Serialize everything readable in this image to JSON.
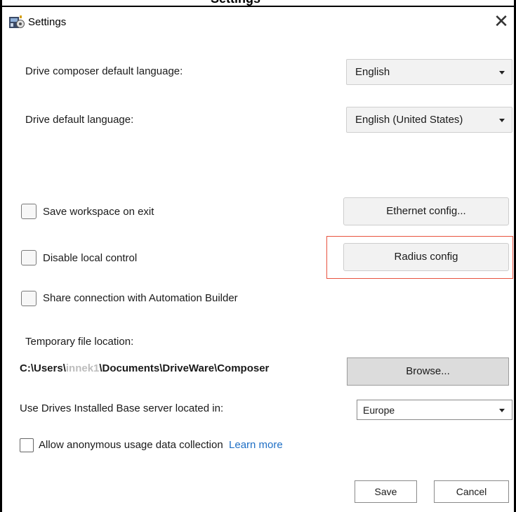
{
  "window": {
    "clipped_title": "Settings",
    "title": "Settings",
    "close_glyph": "✕",
    "icon": "settings-app-icon"
  },
  "language": {
    "composer_label": "Drive composer default language:",
    "composer_value": "English",
    "drive_label": "Drive default language:",
    "drive_value": "English (United States)"
  },
  "options": {
    "save_workspace_label": "Save workspace on exit",
    "save_workspace_checked": false,
    "disable_local_label": "Disable local control",
    "disable_local_checked": false,
    "share_connection_label": "Share connection with Automation Builder",
    "share_connection_checked": false
  },
  "buttons": {
    "ethernet": "Ethernet config...",
    "radius": "Radius config",
    "browse": "Browse...",
    "save": "Save",
    "cancel": "Cancel"
  },
  "temp": {
    "label": "Temporary file location:",
    "path_prefix": "C:\\Users\\",
    "path_user": "innek1",
    "path_suffix": "\\Documents\\DriveWare\\Composer"
  },
  "server": {
    "label": "Use Drives Installed Base server located in:",
    "value": "Europe"
  },
  "usage": {
    "label": "Allow anonymous usage data collection",
    "checked": false,
    "learn_more": "Learn more"
  },
  "colors": {
    "highlight": "#e8533f",
    "link": "#1f6fc5"
  }
}
